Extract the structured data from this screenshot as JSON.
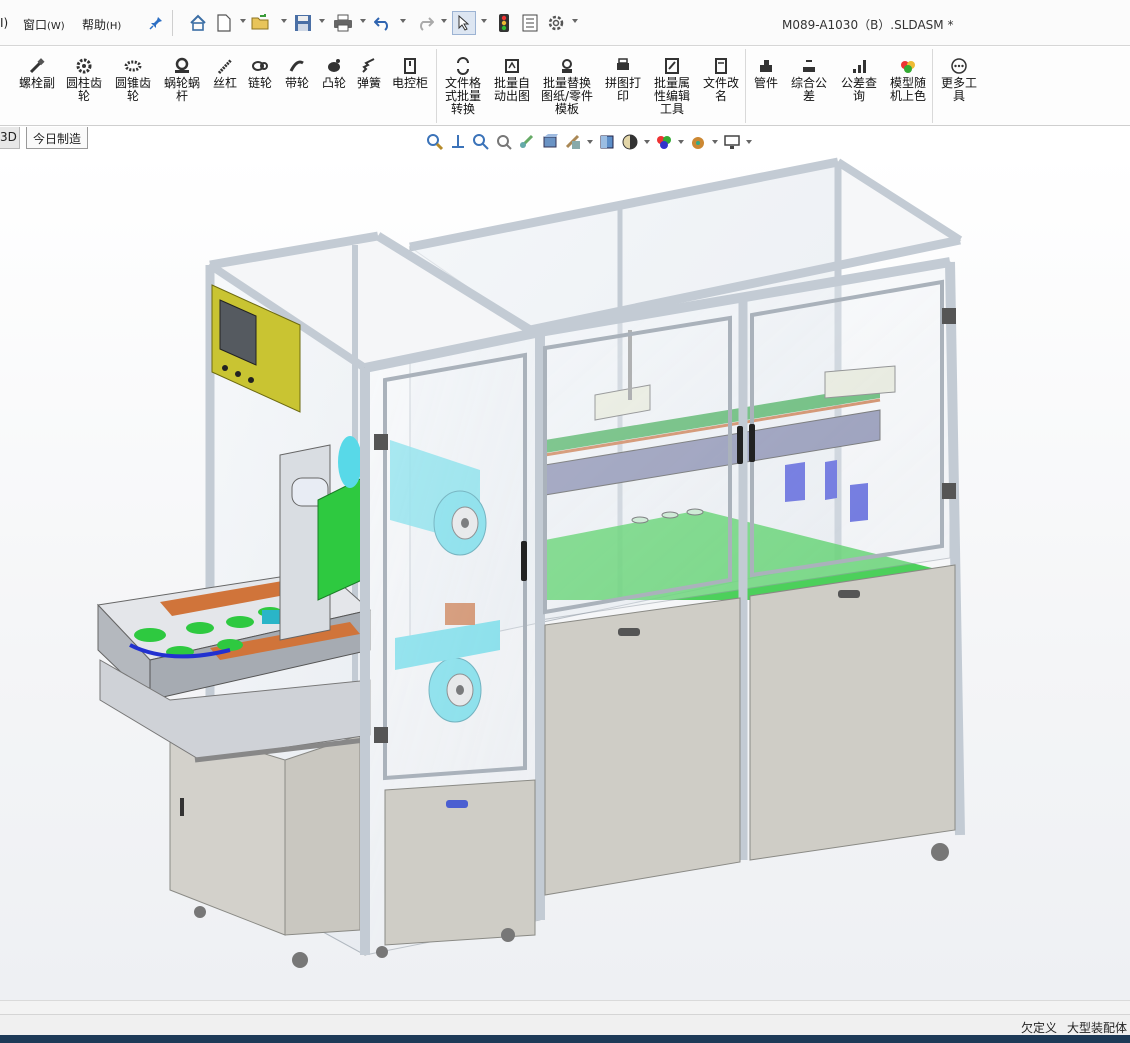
{
  "menu": {
    "partial_left": "I)",
    "window": "窗口",
    "window_key": "(W)",
    "help": "帮助",
    "help_key": "(H)"
  },
  "quick_access": {
    "icons": [
      "pin-icon",
      "home-icon",
      "new-document-icon",
      "open-folder-icon",
      "save-icon",
      "print-icon",
      "undo-icon",
      "redo-icon",
      "select-arrow-icon",
      "traffic-light-icon",
      "file-properties-icon",
      "options-gear-icon"
    ]
  },
  "document": {
    "title": "M089-A1030（B）.SLDASM *"
  },
  "ribbon": {
    "tools": [
      {
        "label": "螺栓副",
        "icon": "bolt-pair-icon"
      },
      {
        "label": "圆柱齿轮",
        "icon": "spur-gear-icon"
      },
      {
        "label": "圆锥齿轮",
        "icon": "bevel-gear-icon"
      },
      {
        "label": "蜗轮蜗杆",
        "icon": "worm-gear-icon"
      },
      {
        "label": "丝杠",
        "icon": "lead-screw-icon"
      },
      {
        "label": "链轮",
        "icon": "sprocket-icon"
      },
      {
        "label": "带轮",
        "icon": "pulley-icon"
      },
      {
        "label": "凸轮",
        "icon": "cam-icon"
      },
      {
        "label": "弹簧",
        "icon": "spring-icon"
      },
      {
        "label": "电控柜",
        "icon": "control-cabinet-icon"
      },
      {
        "label": "文件格式批量转换",
        "icon": "format-convert-icon"
      },
      {
        "label": "批量自动出图",
        "icon": "batch-drawing-icon"
      },
      {
        "label": "批量替换图纸/零件模板",
        "icon": "template-replace-icon"
      },
      {
        "label": "拼图打印",
        "icon": "collage-print-icon"
      },
      {
        "label": "批量属性编辑工具",
        "icon": "property-edit-icon"
      },
      {
        "label": "文件改名",
        "icon": "file-rename-icon"
      },
      {
        "label": "管件",
        "icon": "pipe-fitting-icon"
      },
      {
        "label": "综合公差",
        "icon": "tolerance-icon"
      },
      {
        "label": "公差查询",
        "icon": "tolerance-query-icon"
      },
      {
        "label": "模型随机上色",
        "icon": "random-color-icon"
      },
      {
        "label": "更多工具",
        "icon": "more-tools-icon"
      }
    ]
  },
  "tabs": {
    "partial": "3D",
    "active": "今日制造"
  },
  "heads_up": {
    "icons": [
      "zoom-to-fit-icon",
      "zoom-area-icon",
      "previous-view-icon",
      "section-view-icon",
      "dynamic-annotation-icon",
      "view-orientation-icon",
      "display-style-icon",
      "hide-show-items-icon",
      "edit-appearance-icon",
      "apply-scene-icon",
      "view-settings-icon",
      "display-pane-icon"
    ]
  },
  "model": {
    "frame_color": "#c3cbd4",
    "panel_color": "#cfcdc6",
    "hmi_color": "#c9c432",
    "accent_green": "#2ec940",
    "accent_cyan": "#58d9e8",
    "accent_orange": "#d0743a",
    "accent_blue": "#4b5fd1"
  },
  "status": {
    "underdefined": "欠定义",
    "assembly_mode": "大型装配体"
  }
}
